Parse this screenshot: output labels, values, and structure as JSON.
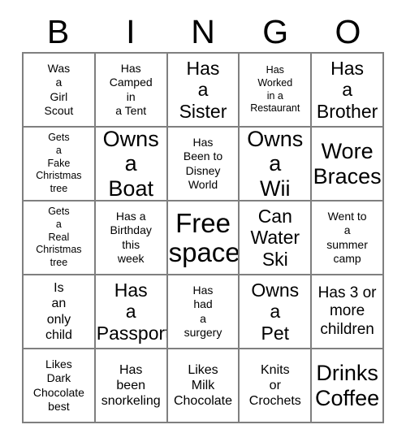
{
  "card": {
    "header_letters": [
      "B",
      "I",
      "N",
      "G",
      "O"
    ],
    "rows": [
      [
        {
          "text": "Was\na\nGirl\nScout",
          "size": "s"
        },
        {
          "text": "Has\nCamped\nin\na Tent",
          "size": "s"
        },
        {
          "text": "Has\na\nSister",
          "size": "xl"
        },
        {
          "text": "Has\nWorked\nin a\nRestaurant",
          "size": "xs"
        },
        {
          "text": "Has\na\nBrother",
          "size": "xl"
        }
      ],
      [
        {
          "text": "Gets\na\nFake\nChristmas\ntree",
          "size": "xs"
        },
        {
          "text": "Owns\na\nBoat",
          "size": "xxl"
        },
        {
          "text": "Has\nBeen to\nDisney\nWorld",
          "size": "s"
        },
        {
          "text": "Owns\na\nWii",
          "size": "xxl"
        },
        {
          "text": "Wore\nBraces",
          "size": "xxl"
        }
      ],
      [
        {
          "text": "Gets\na\nReal\nChristmas\ntree",
          "size": "xs"
        },
        {
          "text": "Has a\nBirthday\nthis\nweek",
          "size": "s"
        },
        {
          "text": "Free\nspace",
          "size": "huge"
        },
        {
          "text": "Can\nWater\nSki",
          "size": "xl"
        },
        {
          "text": "Went to\na\nsummer\ncamp",
          "size": "s"
        }
      ],
      [
        {
          "text": "Is\nan\nonly\nchild",
          "size": "m"
        },
        {
          "text": "Has\na\nPassport",
          "size": "xl"
        },
        {
          "text": "Has\nhad\na\nsurgery",
          "size": "s"
        },
        {
          "text": "Owns\na\nPet",
          "size": "xl"
        },
        {
          "text": "Has 3 or\nmore\nchildren",
          "size": "l"
        }
      ],
      [
        {
          "text": "Likes\nDark\nChocolate\nbest",
          "size": "s"
        },
        {
          "text": "Has\nbeen\nsnorkeling",
          "size": "m"
        },
        {
          "text": "Likes\nMilk\nChocolate",
          "size": "m"
        },
        {
          "text": "Knits\nor\nCrochets",
          "size": "m"
        },
        {
          "text": "Drinks\nCoffee",
          "size": "xxl"
        }
      ]
    ]
  },
  "colors": {
    "border": "#7f7f7f",
    "text": "#000000",
    "background": "#ffffff"
  }
}
